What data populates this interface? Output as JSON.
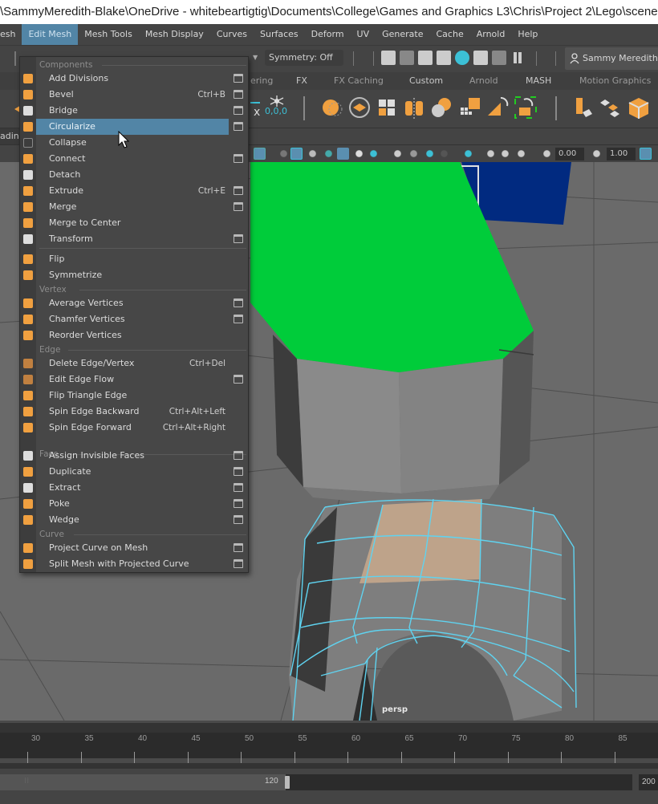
{
  "window": {
    "title": "\\SammyMeredith-Blake\\OneDrive - whitebeartigtig\\Documents\\College\\Games and Graphics L3\\Chris\\Project 2\\Lego\\scene"
  },
  "menubar": {
    "items": [
      {
        "label": "esh"
      },
      {
        "label": "Edit Mesh",
        "active": true
      },
      {
        "label": "Mesh Tools"
      },
      {
        "label": "Mesh Display"
      },
      {
        "label": "Curves"
      },
      {
        "label": "Surfaces"
      },
      {
        "label": "Deform"
      },
      {
        "label": "UV"
      },
      {
        "label": "Generate"
      },
      {
        "label": "Cache"
      },
      {
        "label": "Arnold"
      },
      {
        "label": "Help"
      }
    ]
  },
  "statusline": {
    "symmetry": "Symmetry: Off",
    "user": "Sammy Meredith-B",
    "icons": [
      "render-view-icon",
      "render-current-icon",
      "ipr-render-icon",
      "render-settings-icon",
      "hypershade-icon",
      "render-setup-icon",
      "light-editor-icon",
      "pause-viewport-icon"
    ]
  },
  "shelf": {
    "tabs": [
      "ering",
      "FX",
      "FX Caching",
      "Custom",
      "Arnold",
      "MASH",
      "Motion Graphics"
    ],
    "pivot_readout": "0,0,0"
  },
  "viewport_toolbar": {
    "exposure": "0.00",
    "gamma": "1.00"
  },
  "left_strip": {
    "label": "adin"
  },
  "edit_mesh_menu": {
    "sections": [
      {
        "title": "Components"
      },
      {
        "title": "Vertex"
      },
      {
        "title": "Edge"
      },
      {
        "title": "Face"
      },
      {
        "title": "Curve"
      }
    ],
    "items": [
      {
        "label": "Add Divisions",
        "shortcut": "",
        "option_box": true,
        "icon": "add-divisions-icon"
      },
      {
        "label": "Bevel",
        "shortcut": "Ctrl+B",
        "option_box": true,
        "icon": "bevel-icon"
      },
      {
        "label": "Bridge",
        "shortcut": "",
        "option_box": true,
        "icon": "bridge-icon"
      },
      {
        "label": "Circularize",
        "shortcut": "",
        "option_box": true,
        "icon": "circularize-icon",
        "highlighted": true
      },
      {
        "label": "Collapse",
        "shortcut": "",
        "option_box": false,
        "icon": "collapse-icon"
      },
      {
        "label": "Connect",
        "shortcut": "",
        "option_box": true,
        "icon": "connect-icon"
      },
      {
        "label": "Detach",
        "shortcut": "",
        "option_box": false,
        "icon": "detach-icon"
      },
      {
        "label": "Extrude",
        "shortcut": "Ctrl+E",
        "option_box": true,
        "icon": "extrude-icon"
      },
      {
        "label": "Merge",
        "shortcut": "",
        "option_box": true,
        "icon": "merge-icon"
      },
      {
        "label": "Merge to Center",
        "shortcut": "",
        "option_box": false,
        "icon": "merge-to-center-icon"
      },
      {
        "label": "Transform",
        "shortcut": "",
        "option_box": true,
        "icon": "transform-icon"
      },
      {
        "label": "Flip",
        "shortcut": "",
        "option_box": false,
        "icon": "flip-icon"
      },
      {
        "label": "Symmetrize",
        "shortcut": "",
        "option_box": false,
        "icon": "symmetrize-icon"
      },
      {
        "label": "Average Vertices",
        "shortcut": "",
        "option_box": true,
        "icon": "average-vertices-icon"
      },
      {
        "label": "Chamfer Vertices",
        "shortcut": "",
        "option_box": true,
        "icon": "chamfer-vertices-icon"
      },
      {
        "label": "Reorder Vertices",
        "shortcut": "",
        "option_box": false,
        "icon": "reorder-vertices-icon"
      },
      {
        "label": "Delete Edge/Vertex",
        "shortcut": "Ctrl+Del",
        "option_box": false,
        "icon": "delete-edge-icon"
      },
      {
        "label": "Edit Edge Flow",
        "shortcut": "",
        "option_box": true,
        "icon": "edit-edge-flow-icon"
      },
      {
        "label": "Flip Triangle Edge",
        "shortcut": "",
        "option_box": false,
        "icon": "flip-triangle-edge-icon"
      },
      {
        "label": "Spin Edge Backward",
        "shortcut": "Ctrl+Alt+Left",
        "option_box": false,
        "icon": "spin-edge-backward-icon"
      },
      {
        "label": "Spin Edge Forward",
        "shortcut": "Ctrl+Alt+Right",
        "option_box": false,
        "icon": "spin-edge-forward-icon"
      },
      {
        "label": "Assign Invisible Faces",
        "shortcut": "",
        "option_box": true,
        "icon": "assign-invisible-faces-icon"
      },
      {
        "label": "Duplicate",
        "shortcut": "",
        "option_box": true,
        "icon": "duplicate-icon"
      },
      {
        "label": "Extract",
        "shortcut": "",
        "option_box": true,
        "icon": "extract-icon"
      },
      {
        "label": "Poke",
        "shortcut": "",
        "option_box": true,
        "icon": "poke-icon"
      },
      {
        "label": "Wedge",
        "shortcut": "",
        "option_box": true,
        "icon": "wedge-icon"
      },
      {
        "label": "Project Curve on Mesh",
        "shortcut": "",
        "option_box": true,
        "icon": "project-curve-icon"
      },
      {
        "label": "Split Mesh with Projected Curve",
        "shortcut": "",
        "option_box": true,
        "icon": "split-mesh-icon"
      }
    ]
  },
  "viewport": {
    "camera_label": "persp",
    "colors": {
      "green_face": "#00cc3a",
      "blue_face": "#012a80",
      "wire": "#5fd3f0",
      "selected_faces": "#c9a98c"
    }
  },
  "timeslider": {
    "ticks": [
      "30",
      "35",
      "40",
      "45",
      "50",
      "55",
      "60",
      "65",
      "70",
      "75",
      "80",
      "85"
    ]
  },
  "range_slider": {
    "end_value": "120",
    "max_value": "200"
  },
  "colors": {
    "accent": "#5285a6",
    "menu_bg": "#474747",
    "ui_bg": "#444444",
    "orange_icon": "#f0a040"
  }
}
